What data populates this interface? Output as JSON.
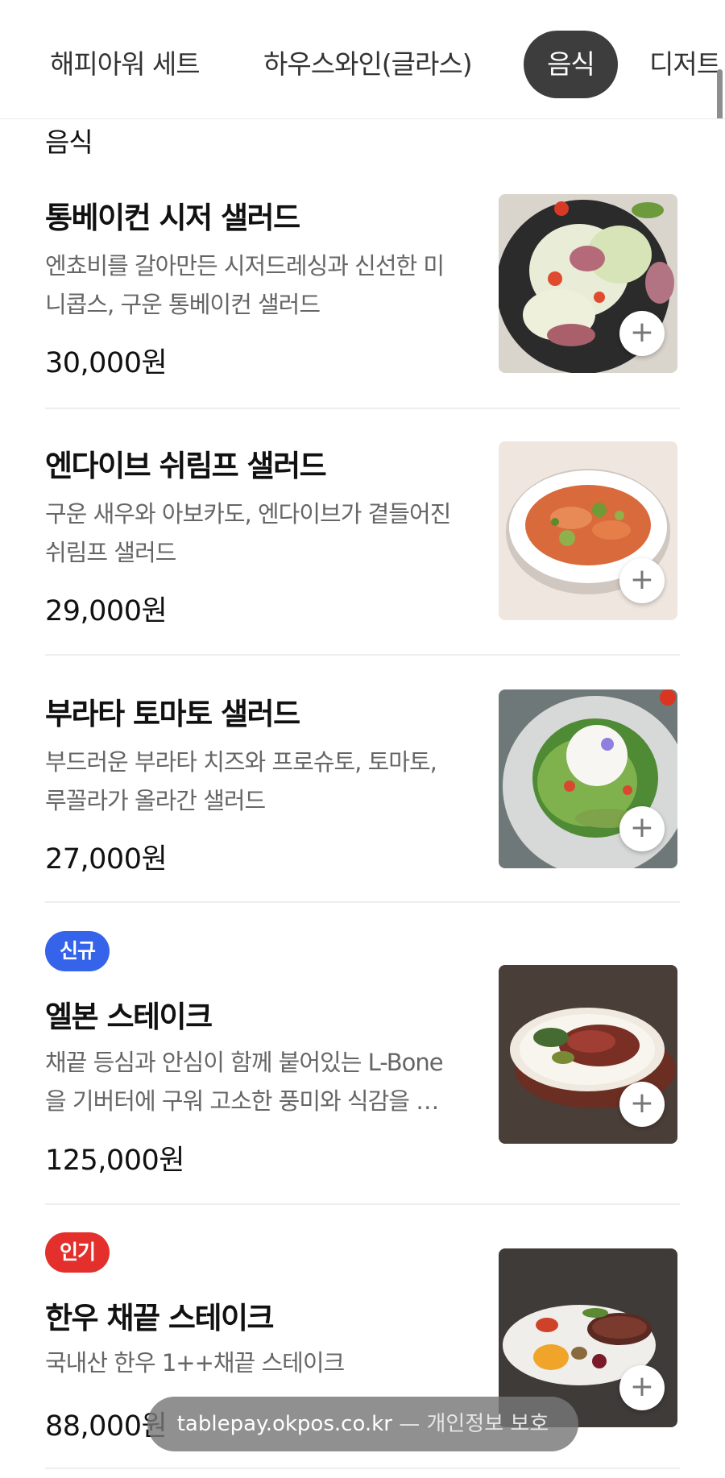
{
  "tabs": [
    {
      "label": "해피아워 세트",
      "active": false
    },
    {
      "label": "하우스와인(글라스)",
      "active": false
    },
    {
      "label": "음식",
      "active": true
    },
    {
      "label": "디저트",
      "active": false
    }
  ],
  "section_title": "음식",
  "items": [
    {
      "badge": "",
      "name": "통베이컨 시저 샐러드",
      "desc1": "엔쵸비를 갈아만든 시저드레싱과 신선한 미",
      "desc2": "니콥스, 구운 통베이컨 샐러드",
      "price": "30,000원",
      "image_icon": "caesar-salad"
    },
    {
      "badge": "",
      "name": "엔다이브 쉬림프 샐러드",
      "desc1": "구운 새우와 아보카도, 엔다이브가 곁들어진",
      "desc2": "쉬림프 샐러드",
      "price": "29,000원",
      "image_icon": "shrimp-salad"
    },
    {
      "badge": "",
      "name": "부라타 토마토 샐러드",
      "desc1": "부드러운 부라타 치즈와 프로슈토, 토마토,",
      "desc2": "루꼴라가 올라간 샐러드",
      "price": "27,000원",
      "image_icon": "burrata-salad"
    },
    {
      "badge": "신규",
      "badge_color": "#3563e9",
      "name": "엘본 스테이크",
      "desc1": "채끝 등심과 안심이 함께 붙어있는 L-Bone",
      "desc2": "을 기버터에 구워 고소한 풍미와 식감을 …",
      "price": "125,000원",
      "image_icon": "lbone-steak"
    },
    {
      "badge": "인기",
      "badge_color": "#e4302c",
      "name": "한우 채끝 스테이크",
      "desc1": "국내산 한우 1++채끝 스테이크",
      "desc2": "",
      "price": "88,000원",
      "image_icon": "hanwoo-steak"
    }
  ],
  "add_button_symbol": "+",
  "browser_bar": {
    "host": "tablepay.okpos.co.kr",
    "separator": "—",
    "privacy": "개인정보 보호"
  }
}
